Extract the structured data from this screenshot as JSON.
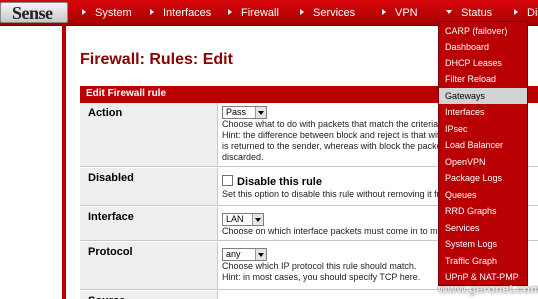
{
  "brand": {
    "logo_text": "Sense"
  },
  "nav": {
    "items": [
      {
        "label": "System"
      },
      {
        "label": "Interfaces"
      },
      {
        "label": "Firewall"
      },
      {
        "label": "Services"
      },
      {
        "label": "VPN"
      },
      {
        "label": "Status"
      },
      {
        "label": "Diag"
      }
    ]
  },
  "page": {
    "title": "Firewall: Rules: Edit"
  },
  "form": {
    "header": "Edit Firewall rule",
    "action": {
      "label": "Action",
      "value": "Pass",
      "help1": "Choose what to do with packets that match the criteria spec",
      "help2": "Hint: the difference between block and reject is that with r",
      "help3": "is returned to the sender, whereas with block the packet",
      "help4": "discarded."
    },
    "disabled": {
      "label": "Disabled",
      "checkbox_label": "Disable this rule",
      "help": "Set this option to disable this rule without removing it fr"
    },
    "interface": {
      "label": "Interface",
      "value": "LAN",
      "help": "Choose on which interface packets must come in to mat"
    },
    "protocol": {
      "label": "Protocol",
      "value": "any",
      "help1": "Choose which IP protocol this rule should match.",
      "help2": "Hint: in most cases, you should specify TCP  here."
    },
    "source": {
      "label": "Source"
    }
  },
  "status_menu": {
    "items": [
      {
        "label": "CARP (failover)"
      },
      {
        "label": "Dashboard"
      },
      {
        "label": "DHCP Leases"
      },
      {
        "label": "Filter Reload"
      },
      {
        "label": "Gateways",
        "highlighted": true
      },
      {
        "label": "Interfaces"
      },
      {
        "label": "IPsec"
      },
      {
        "label": "Load Balancer"
      },
      {
        "label": "OpenVPN"
      },
      {
        "label": "Package Logs"
      },
      {
        "label": "Queues"
      },
      {
        "label": "RRD Graphs"
      },
      {
        "label": "Services"
      },
      {
        "label": "System Logs"
      },
      {
        "label": "Traffic Graph"
      },
      {
        "label": "UPnP & NAT-PMP"
      }
    ]
  },
  "watermark": "www.geronet.com.ar",
  "colors": {
    "accent": "#b80003",
    "title": "#8b0000",
    "menu_highlight": "#d3d3d3"
  }
}
